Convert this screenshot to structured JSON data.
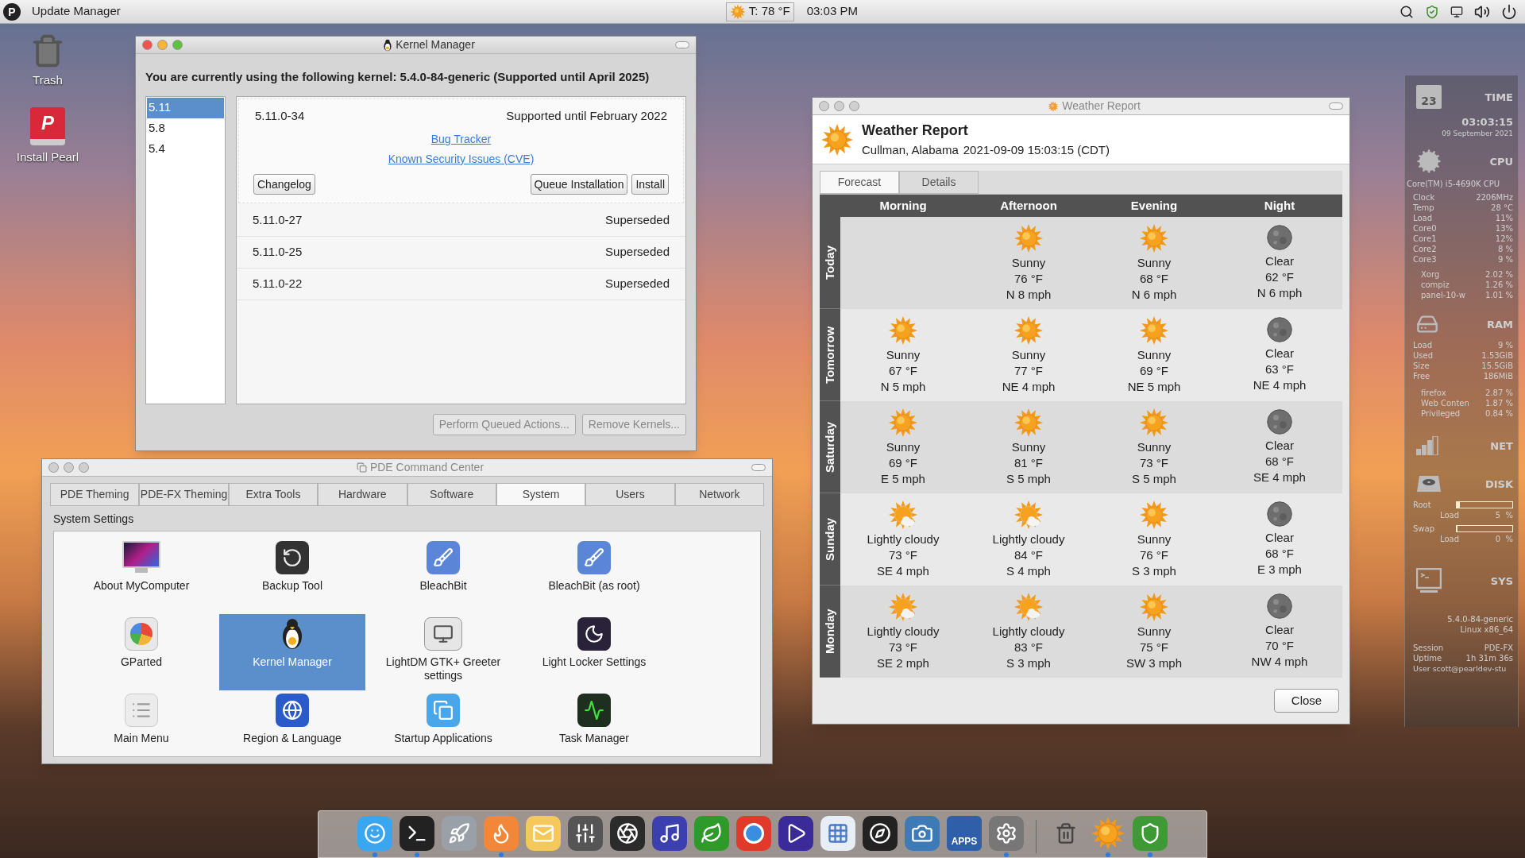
{
  "top_bar": {
    "logo": "P",
    "app_title": "Update Manager",
    "weather": "T: 78 °F",
    "clock": "03:03 PM"
  },
  "desktop_icons": [
    {
      "kind": "trash",
      "label": "Trash"
    },
    {
      "kind": "installer",
      "label": "Install Pearl",
      "badge": "P"
    }
  ],
  "kernel_window": {
    "title": "Kernel Manager",
    "focused": true,
    "current": "You are currently using the following kernel: 5.4.0-84-generic (Supported until April 2025)",
    "series": [
      {
        "label": "5.11",
        "selected": true
      },
      {
        "label": "5.8",
        "selected": false
      },
      {
        "label": "5.4",
        "selected": false
      }
    ],
    "kernels": [
      {
        "version": "5.11.0-34",
        "status": "Supported until February 2022",
        "expanded": true,
        "links": [
          "Bug Tracker",
          "Known Security Issues (CVE)"
        ],
        "buttons": [
          "Changelog",
          "Queue Installation",
          "Install"
        ]
      },
      {
        "version": "5.11.0-27",
        "status": "Superseded",
        "expanded": false
      },
      {
        "version": "5.11.0-25",
        "status": "Superseded",
        "expanded": false
      },
      {
        "version": "5.11.0-22",
        "status": "Superseded",
        "expanded": false
      }
    ],
    "buttons": [
      {
        "label": "Perform Queued Actions...",
        "disabled": true
      },
      {
        "label": "Remove Kernels...",
        "disabled": true
      }
    ]
  },
  "pde_window": {
    "title": "PDE Command Center",
    "focused": false,
    "tabs": [
      {
        "label": "PDE Theming",
        "selected": false
      },
      {
        "label": "PDE-FX Theming",
        "selected": false
      },
      {
        "label": "Extra Tools",
        "selected": false
      },
      {
        "label": "Hardware",
        "selected": false
      },
      {
        "label": "Software",
        "selected": false
      },
      {
        "label": "System",
        "selected": true
      },
      {
        "label": "Users",
        "selected": false
      },
      {
        "label": "Network",
        "selected": false
      }
    ],
    "section": "System Settings",
    "items": [
      {
        "label": "About MyComputer",
        "kind": "monitor",
        "selected": false
      },
      {
        "label": "Backup Tool",
        "kind": "backup",
        "selected": false
      },
      {
        "label": "BleachBit",
        "kind": "broom",
        "selected": false
      },
      {
        "label": "BleachBit (as root)",
        "kind": "broom",
        "selected": false
      },
      {
        "label": "GParted",
        "kind": "disk",
        "selected": false
      },
      {
        "label": "Kernel Manager",
        "kind": "penguin",
        "selected": true
      },
      {
        "label": "LightDM GTK+ Greeter settings",
        "kind": "login",
        "selected": false
      },
      {
        "label": "Light Locker Settings",
        "kind": "moon",
        "selected": false
      },
      {
        "label": "Main Menu",
        "kind": "list",
        "selected": false
      },
      {
        "label": "Region & Language",
        "kind": "globe",
        "selected": false
      },
      {
        "label": "Startup Applications",
        "kind": "windows",
        "selected": false
      },
      {
        "label": "Task Manager",
        "kind": "pulse",
        "selected": false
      }
    ]
  },
  "weather_window": {
    "title": "Weather Report",
    "focused": false,
    "heading": "Weather Report",
    "location": "Cullman, Alabama",
    "timestamp": "2021-09-09 15:03:15 (CDT)",
    "tabs": [
      {
        "label": "Forecast",
        "selected": true
      },
      {
        "label": "Details",
        "selected": false
      }
    ],
    "periods": [
      "Morning",
      "Afternoon",
      "Evening",
      "Night"
    ],
    "days": [
      {
        "name": "Today",
        "cells": [
          {
            "kind": "none"
          },
          {
            "kind": "sunny",
            "condition": "Sunny",
            "temp": "76 °F",
            "wind": "N 8 mph"
          },
          {
            "kind": "sunny",
            "condition": "Sunny",
            "temp": "68 °F",
            "wind": "N 6 mph"
          },
          {
            "kind": "clear",
            "condition": "Clear",
            "temp": "62 °F",
            "wind": "N 6 mph"
          }
        ]
      },
      {
        "name": "Tomorrow",
        "cells": [
          {
            "kind": "sunny",
            "condition": "Sunny",
            "temp": "67 °F",
            "wind": "N 5 mph"
          },
          {
            "kind": "sunny",
            "condition": "Sunny",
            "temp": "77 °F",
            "wind": "NE 4 mph"
          },
          {
            "kind": "sunny",
            "condition": "Sunny",
            "temp": "69 °F",
            "wind": "NE 5 mph"
          },
          {
            "kind": "clear",
            "condition": "Clear",
            "temp": "63 °F",
            "wind": "NE 4 mph"
          }
        ]
      },
      {
        "name": "Saturday",
        "cells": [
          {
            "kind": "sunny",
            "condition": "Sunny",
            "temp": "69 °F",
            "wind": "E 5 mph"
          },
          {
            "kind": "sunny",
            "condition": "Sunny",
            "temp": "81 °F",
            "wind": "S 5 mph"
          },
          {
            "kind": "sunny",
            "condition": "Sunny",
            "temp": "73 °F",
            "wind": "S 5 mph"
          },
          {
            "kind": "clear",
            "condition": "Clear",
            "temp": "68 °F",
            "wind": "SE 4 mph"
          }
        ]
      },
      {
        "name": "Sunday",
        "cells": [
          {
            "kind": "cloudy",
            "condition": "Lightly cloudy",
            "temp": "73 °F",
            "wind": "SE 4 mph"
          },
          {
            "kind": "cloudy",
            "condition": "Lightly cloudy",
            "temp": "84 °F",
            "wind": "S 4 mph"
          },
          {
            "kind": "sunny",
            "condition": "Sunny",
            "temp": "76 °F",
            "wind": "S 3 mph"
          },
          {
            "kind": "clear",
            "condition": "Clear",
            "temp": "68 °F",
            "wind": "E 3 mph"
          }
        ]
      },
      {
        "name": "Monday",
        "cells": [
          {
            "kind": "cloudy",
            "condition": "Lightly cloudy",
            "temp": "73 °F",
            "wind": "SE 2 mph"
          },
          {
            "kind": "cloudy",
            "condition": "Lightly cloudy",
            "temp": "83 °F",
            "wind": "S 3 mph"
          },
          {
            "kind": "sunny",
            "condition": "Sunny",
            "temp": "75 °F",
            "wind": "SW 3 mph"
          },
          {
            "kind": "clear",
            "condition": "Clear",
            "temp": "70 °F",
            "wind": "NW 4 mph"
          }
        ]
      }
    ],
    "close": "Close"
  },
  "conky": {
    "time": {
      "calendar_day": "23",
      "heading": "TIME",
      "clock": "03:03:15",
      "date": "09 September 2021"
    },
    "cpu": {
      "heading": "CPU",
      "model": "Core(TM) i5-4690K CPU",
      "stats": [
        {
          "label": "Clock",
          "value": "2206MHz"
        },
        {
          "label": "Temp",
          "value": "28 °C"
        },
        {
          "label": "Load",
          "value": "11%"
        },
        {
          "label": "Core0",
          "value": "13%"
        },
        {
          "label": "Core1",
          "value": "12%"
        },
        {
          "label": "Core2",
          "value": "8 %"
        },
        {
          "label": "Core3",
          "value": "9 %"
        }
      ],
      "processes": [
        {
          "label": "Xorg",
          "value": "2.02 %"
        },
        {
          "label": "compiz",
          "value": "1.26 %"
        },
        {
          "label": "panel-10-w",
          "value": "1.01 %"
        }
      ]
    },
    "ram": {
      "heading": "RAM",
      "stats": [
        {
          "label": "Load",
          "value": "9  %"
        },
        {
          "label": "Used",
          "value": "1.53GiB"
        },
        {
          "label": "Size",
          "value": "15.5GiB"
        },
        {
          "label": "Free",
          "value": "186MiB"
        }
      ],
      "processes": [
        {
          "label": "firefox",
          "value": "2.87 %"
        },
        {
          "label": "Web Conten",
          "value": "1.87 %"
        },
        {
          "label": "Privileged",
          "value": "0.84 %"
        }
      ]
    },
    "net": {
      "heading": "NET"
    },
    "disk": {
      "heading": "DISK",
      "volumes": [
        {
          "name": "Root",
          "level": 0.05,
          "load_label": "Load",
          "load": "5  %"
        },
        {
          "name": "Swap",
          "level": 0,
          "load_label": "Load",
          "load": "0  %"
        }
      ]
    },
    "sys": {
      "heading": "SYS",
      "kernel": "5.4.0-84-generic",
      "arch": "Linux x86_64",
      "stats": [
        {
          "label": "Session",
          "value": "PDE-FX"
        },
        {
          "label": "Uptime",
          "value": "1h 31m 36s"
        }
      ],
      "user": "User scott@pearldev-stu"
    }
  },
  "dock": {
    "items": [
      {
        "kind": "finder",
        "running": true
      },
      {
        "kind": "terminal",
        "running": true
      },
      {
        "kind": "rocket",
        "running": false
      },
      {
        "kind": "firefox",
        "running": true
      },
      {
        "kind": "mail",
        "running": false
      },
      {
        "kind": "mixer",
        "running": false
      },
      {
        "kind": "obs",
        "running": false
      },
      {
        "kind": "music",
        "running": false
      },
      {
        "kind": "leaf",
        "running": false
      },
      {
        "kind": "record",
        "running": false
      },
      {
        "kind": "play",
        "running": false
      },
      {
        "kind": "grid",
        "running": false
      },
      {
        "kind": "compass",
        "running": false
      },
      {
        "kind": "camera",
        "running": false
      },
      {
        "kind": "appstore",
        "running": false,
        "label": "APPS"
      },
      {
        "kind": "settings",
        "running": true
      },
      {
        "kind": "separator"
      },
      {
        "kind": "trash",
        "running": false
      },
      {
        "kind": "weather",
        "running": true
      },
      {
        "kind": "shield",
        "running": true
      }
    ]
  }
}
